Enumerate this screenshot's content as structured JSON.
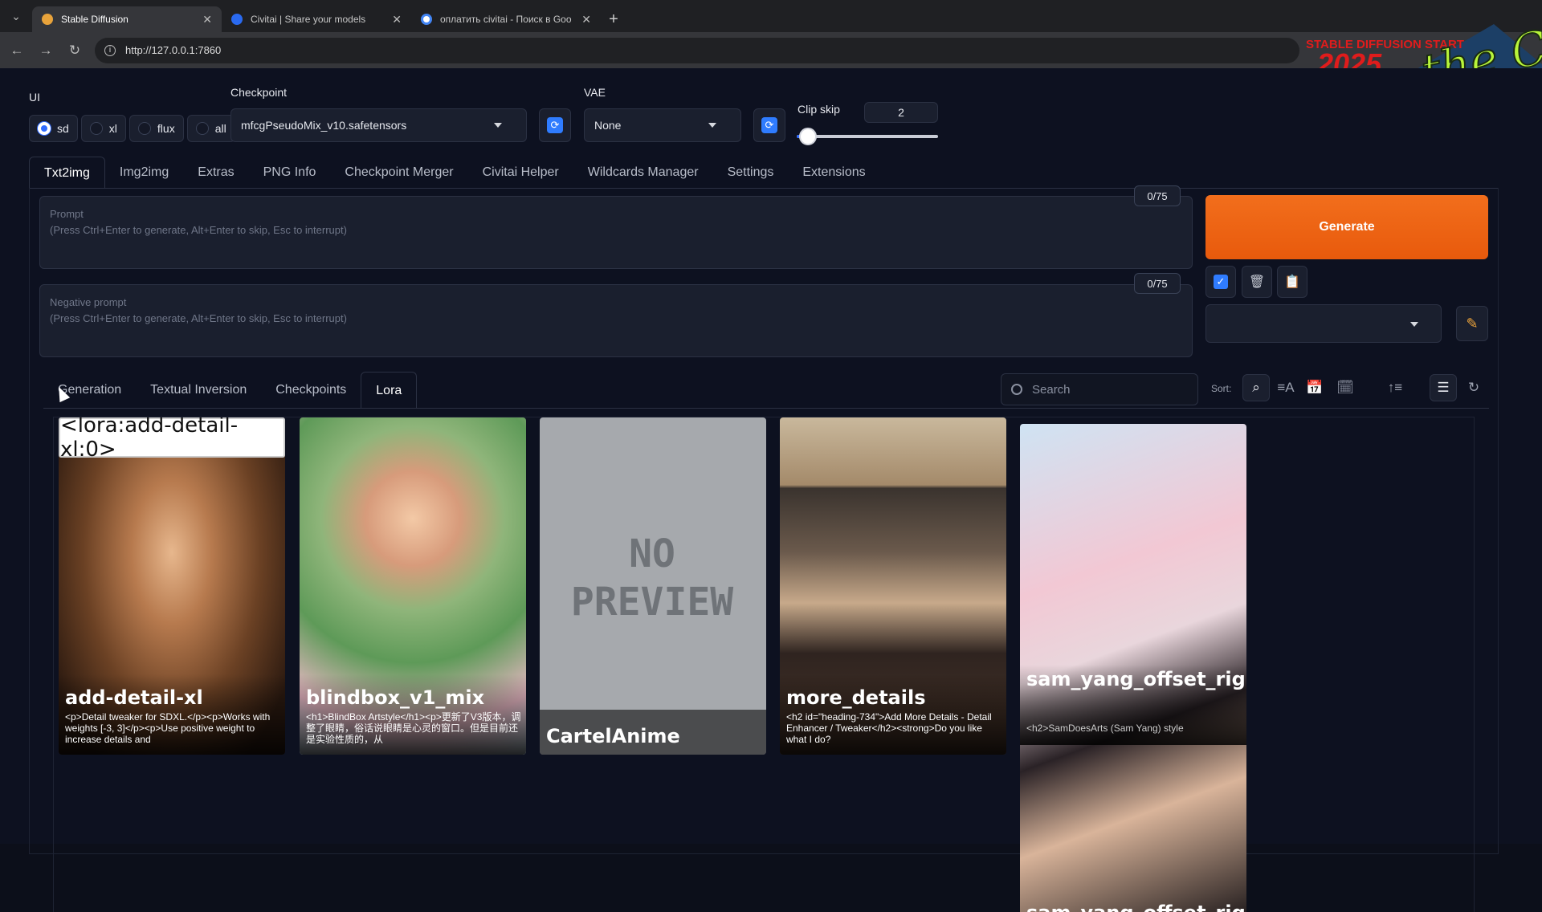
{
  "browser": {
    "tabs": [
      {
        "title": "Stable Diffusion",
        "favicon_color": "#e8a33b"
      },
      {
        "title": "Civitai | Share your models",
        "favicon_color": "#2a6af0"
      },
      {
        "title": "оплатить civitai - Поиск в Goo",
        "favicon_color": "#ffffff"
      }
    ],
    "url": "http://127.0.0.1:7860",
    "logo": {
      "line1": "STABLE DIFFUSION START",
      "line2": "2025",
      "script": "the CarteL"
    }
  },
  "top": {
    "ui_label": "UI",
    "ui_options": [
      {
        "label": "sd",
        "selected": true
      },
      {
        "label": "xl",
        "selected": false
      },
      {
        "label": "flux",
        "selected": false
      },
      {
        "label": "all",
        "selected": false
      }
    ],
    "checkpoint_label": "Checkpoint",
    "checkpoint_value": "mfcgPseudoMix_v10.safetensors",
    "vae_label": "VAE",
    "vae_value": "None",
    "clip_skip_label": "Clip skip",
    "clip_skip_value": "2",
    "clip_skip_fraction": 0.08
  },
  "main_tabs": [
    {
      "label": "Txt2img",
      "active": true
    },
    {
      "label": "Img2img",
      "active": false
    },
    {
      "label": "Extras",
      "active": false
    },
    {
      "label": "PNG Info",
      "active": false
    },
    {
      "label": "Checkpoint Merger",
      "active": false
    },
    {
      "label": "Civitai Helper",
      "active": false
    },
    {
      "label": "Wildcards Manager",
      "active": false
    },
    {
      "label": "Settings",
      "active": false
    },
    {
      "label": "Extensions",
      "active": false
    }
  ],
  "prompt": {
    "label": "Prompt",
    "placeholder": "(Press Ctrl+Enter to generate, Alt+Enter to skip, Esc to interrupt)",
    "counter": "0/75"
  },
  "negative_prompt": {
    "label": "Negative prompt",
    "placeholder": "(Press Ctrl+Enter to generate, Alt+Enter to skip, Esc to interrupt)",
    "counter": "0/75"
  },
  "generate_label": "Generate",
  "sub_tabs": [
    {
      "label": "Generation",
      "active": false
    },
    {
      "label": "Textual Inversion",
      "active": false
    },
    {
      "label": "Checkpoints",
      "active": false
    },
    {
      "label": "Lora",
      "active": true
    }
  ],
  "search_placeholder": "Search",
  "sort_label": "Sort:",
  "tooltip": "<lora:add-detail-xl:0>",
  "cards": [
    {
      "name": "add-detail-xl",
      "desc": "<p>Detail tweaker for SDXL.</p><p>Works with weights [-3, 3]</p><p>Use positive weight to increase details and"
    },
    {
      "name": "blindbox_v1_mix",
      "desc": "<h1>BlindBox Artstyle</h1><p>更新了V3版本，调整了眼睛，俗话说眼睛是心灵的窗口。但是目前还是实验性质的，从"
    },
    {
      "name": "CartelAnime",
      "desc": "",
      "no_preview": "NO PREVIEW"
    },
    {
      "name": "more_details",
      "desc": "<h2 id=\"heading-734\">Add More Details - Detail Enhancer / Tweaker</h2><strong>Do you like what I do?"
    },
    {
      "name": "sam_yang_offset_right_filesize",
      "desc": "<h2>SamDoesArts (Sam Yang) style"
    },
    {
      "name": "sam_yang_offset_right"
    }
  ]
}
